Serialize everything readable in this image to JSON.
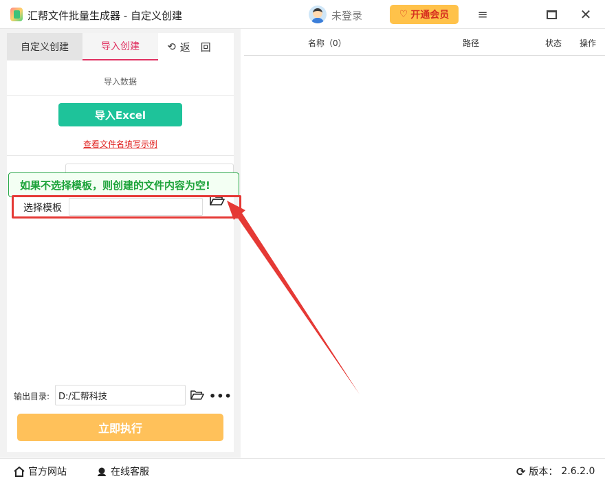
{
  "window": {
    "title": "汇帮文件批量生成器 - 自定义创建",
    "login_text": "未登录",
    "vip_label": "开通会员"
  },
  "left_panel": {
    "tabs": [
      {
        "label": "自定义创建"
      },
      {
        "label": "导入创建"
      },
      {
        "label": "返　回"
      }
    ],
    "section_label": "导入数据",
    "import_button": "导入Excel",
    "example_link": "查看文件名填写示例",
    "tooltip": "如果不选择模板，则创建的文件内容为空!",
    "template_label": "选择模板",
    "template_value": "",
    "output_label": "输出目录:",
    "output_value": "D:/汇帮科技",
    "run_button": "立即执行"
  },
  "table": {
    "columns": [
      "名称（0）",
      "路径",
      "状态",
      "操作"
    ]
  },
  "statusbar": {
    "website": "官方网站",
    "service": "在线客服",
    "version_label": "版本：",
    "version": "2.6.2.0"
  },
  "colors": {
    "accent_green": "#1ec39a",
    "tab_active": "#e03060",
    "run_button": "#ffc15a",
    "vip": "#ffc24a",
    "highlight": "#e53935"
  }
}
